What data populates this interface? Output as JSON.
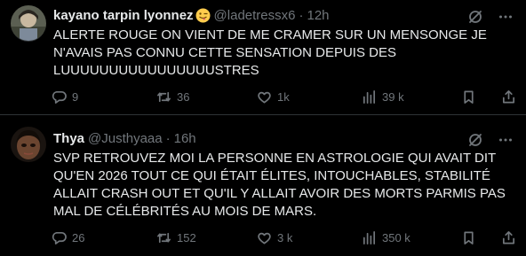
{
  "tweets": [
    {
      "author_name": "kayano tarpin lyonnez",
      "handle": "@ladetressx6",
      "separator": "·",
      "time": "12h",
      "text": "ALERTE ROUGE ON VIENT DE ME CRAMER SUR UN MENSONGE JE N'AVAIS PAS CONNU CETTE SENSATION DEPUIS DES LUUUUUUUUUUUUUUUUSTRES",
      "replies": "9",
      "retweets": "36",
      "likes": "1k",
      "views": "39 k"
    },
    {
      "author_name": "Thya",
      "handle": "@Justhyaaa",
      "separator": "·",
      "time": "16h",
      "text": "SVP RETROUVEZ MOI LA PERSONNE EN ASTROLOGIE QUI AVAIT DIT QU'EN 2026 TOUT CE QUI ÉTAIT ÉLITES, INTOUCHABLES, STABILITÉ ALLAIT CRASH OUT ET QU'IL Y ALLAIT AVOIR DES MORTS PARMIS PAS MAL DE CÉLÉBRITÉS AU MOIS DE MARS.",
      "replies": "26",
      "retweets": "152",
      "likes": "3 k",
      "views": "350 k"
    }
  ],
  "colors": {
    "background": "#000000",
    "text": "#e7e9ea",
    "muted": "#71767b",
    "divider": "#2f3336"
  },
  "icons": [
    "grok-icon",
    "more-icon",
    "reply-icon",
    "retweet-icon",
    "like-icon",
    "views-icon",
    "bookmark-icon",
    "share-icon",
    "winking-tongue-emoji"
  ]
}
